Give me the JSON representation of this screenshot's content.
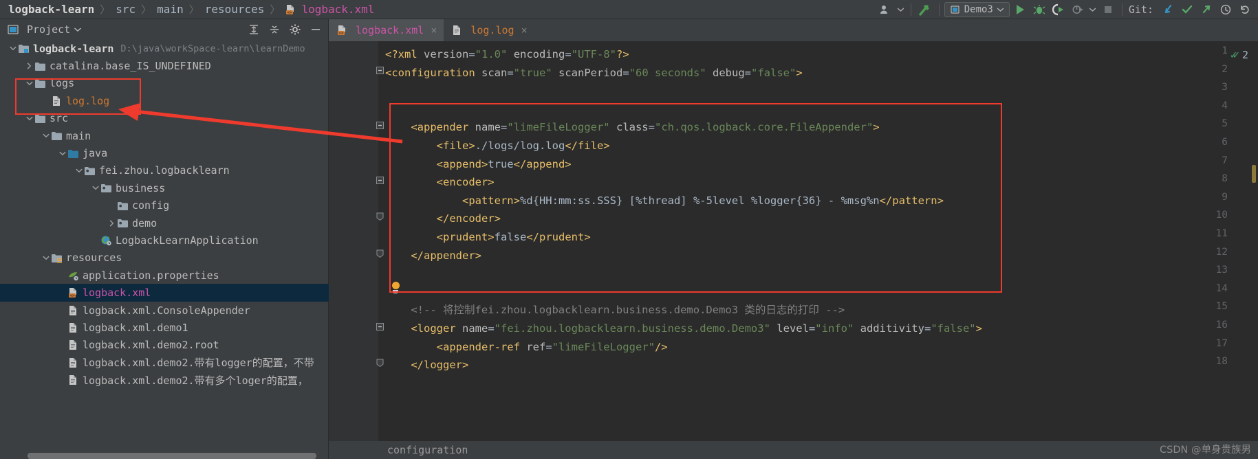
{
  "breadcrumb": {
    "items": [
      {
        "label": "logback-learn",
        "kind": "project"
      },
      {
        "label": "src",
        "kind": "dir"
      },
      {
        "label": "main",
        "kind": "dir"
      },
      {
        "label": "resources",
        "kind": "dir"
      },
      {
        "label": "logback.xml",
        "kind": "xml-file"
      }
    ],
    "separator": "〉"
  },
  "toolbar": {
    "run_config": "Demo3",
    "git_label": "Git:",
    "buttons": [
      {
        "name": "user-icon",
        "glyph": "♟"
      },
      {
        "name": "build-hammer-icon",
        "glyph": "⚒"
      },
      {
        "name": "run-button",
        "glyph": "▶"
      },
      {
        "name": "debug-button",
        "glyph": "✱"
      },
      {
        "name": "run-with-coverage-button",
        "glyph": "◐"
      },
      {
        "name": "profile-button",
        "glyph": "◔"
      },
      {
        "name": "stop-button",
        "glyph": "■"
      },
      {
        "name": "git-update-button",
        "glyph": "↙"
      },
      {
        "name": "git-commit-button",
        "glyph": "✓"
      },
      {
        "name": "git-push-button",
        "glyph": "↗"
      },
      {
        "name": "git-history-button",
        "glyph": "◴"
      },
      {
        "name": "git-rollback-button",
        "glyph": "↶"
      }
    ]
  },
  "project_panel": {
    "title": "Project",
    "header_buttons": [
      "expand-all",
      "collapse-all",
      "settings-gear",
      "hide-panel"
    ],
    "tree": [
      {
        "indent": 0,
        "arrow": "down",
        "icon": "module-folder",
        "label": "logback-learn",
        "bold": true,
        "path": "D:\\java\\workSpace-learn\\learnDemo"
      },
      {
        "indent": 1,
        "arrow": "right",
        "icon": "folder",
        "label": "catalina.base_IS_UNDEFINED"
      },
      {
        "indent": 1,
        "arrow": "down",
        "icon": "folder",
        "label": "logs"
      },
      {
        "indent": 2,
        "arrow": "none",
        "icon": "file",
        "label": "log.log",
        "color": "orange"
      },
      {
        "indent": 1,
        "arrow": "down",
        "icon": "folder",
        "label": "src"
      },
      {
        "indent": 2,
        "arrow": "down",
        "icon": "folder",
        "label": "main"
      },
      {
        "indent": 3,
        "arrow": "down",
        "icon": "source-folder",
        "label": "java"
      },
      {
        "indent": 4,
        "arrow": "down",
        "icon": "package",
        "label": "fei.zhou.logbacklearn"
      },
      {
        "indent": 5,
        "arrow": "down",
        "icon": "package",
        "label": "business"
      },
      {
        "indent": 6,
        "arrow": "none",
        "icon": "package",
        "label": "config"
      },
      {
        "indent": 6,
        "arrow": "right",
        "icon": "package",
        "label": "demo"
      },
      {
        "indent": 5,
        "arrow": "none",
        "icon": "spring-class",
        "label": "LogbackLearnApplication"
      },
      {
        "indent": 2,
        "arrow": "down",
        "icon": "resources-folder",
        "label": "resources"
      },
      {
        "indent": 3,
        "arrow": "none",
        "icon": "spring-properties",
        "label": "application.properties"
      },
      {
        "indent": 3,
        "arrow": "none",
        "icon": "xml-file",
        "label": "logback.xml",
        "color": "pink",
        "selected": true
      },
      {
        "indent": 3,
        "arrow": "none",
        "icon": "file",
        "label": "logback.xml.ConsoleAppender"
      },
      {
        "indent": 3,
        "arrow": "none",
        "icon": "file",
        "label": "logback.xml.demo1"
      },
      {
        "indent": 3,
        "arrow": "none",
        "icon": "file",
        "label": "logback.xml.demo2.root"
      },
      {
        "indent": 3,
        "arrow": "none",
        "icon": "file",
        "label": "logback.xml.demo2.带有logger的配置，不带"
      },
      {
        "indent": 3,
        "arrow": "none",
        "icon": "file",
        "label": "logback.xml.demo2.带有多个loger的配置，"
      }
    ]
  },
  "editor": {
    "tabs": [
      {
        "label": "logback.xml",
        "icon": "xml-file",
        "active": true,
        "close": "×"
      },
      {
        "label": "log.log",
        "icon": "file",
        "active": false,
        "close": "×"
      }
    ],
    "inspection_count": "2",
    "status_text": "configuration",
    "lines": [
      {
        "n": 1,
        "fold": "",
        "segments": [
          {
            "t": "<?xml ",
            "c": "tag"
          },
          {
            "t": "version",
            "c": "attr"
          },
          {
            "t": "=",
            "c": "txt"
          },
          {
            "t": "\"1.0\"",
            "c": "val"
          },
          {
            "t": " ",
            "c": "txt"
          },
          {
            "t": "encoding",
            "c": "attr"
          },
          {
            "t": "=",
            "c": "txt"
          },
          {
            "t": "\"UTF-8\"",
            "c": "val"
          },
          {
            "t": "?>",
            "c": "tag"
          }
        ]
      },
      {
        "n": 2,
        "fold": "minus",
        "segments": [
          {
            "t": "<configuration ",
            "c": "tag"
          },
          {
            "t": "scan",
            "c": "attr"
          },
          {
            "t": "=",
            "c": "txt"
          },
          {
            "t": "\"true\"",
            "c": "val"
          },
          {
            "t": " ",
            "c": "txt"
          },
          {
            "t": "scanPeriod",
            "c": "attr"
          },
          {
            "t": "=",
            "c": "txt"
          },
          {
            "t": "\"60 seconds\"",
            "c": "val"
          },
          {
            "t": " ",
            "c": "txt"
          },
          {
            "t": "debug",
            "c": "attr"
          },
          {
            "t": "=",
            "c": "txt"
          },
          {
            "t": "\"false\"",
            "c": "val"
          },
          {
            "t": ">",
            "c": "tag"
          }
        ]
      },
      {
        "n": 3,
        "fold": "",
        "segments": []
      },
      {
        "n": 4,
        "fold": "",
        "segments": []
      },
      {
        "n": 5,
        "fold": "minus",
        "indent": 4,
        "segments": [
          {
            "t": "<appender ",
            "c": "tag"
          },
          {
            "t": "name",
            "c": "attr"
          },
          {
            "t": "=",
            "c": "txt"
          },
          {
            "t": "\"limeFileLogger\"",
            "c": "val"
          },
          {
            "t": " ",
            "c": "txt"
          },
          {
            "t": "class",
            "c": "attr"
          },
          {
            "t": "=",
            "c": "txt"
          },
          {
            "t": "\"ch.qos.logback.core.FileAppender\"",
            "c": "val"
          },
          {
            "t": ">",
            "c": "tag"
          }
        ]
      },
      {
        "n": 6,
        "fold": "",
        "indent": 8,
        "segments": [
          {
            "t": "<file>",
            "c": "tag"
          },
          {
            "t": "./logs/log.log",
            "c": "txt"
          },
          {
            "t": "</file>",
            "c": "tag"
          }
        ]
      },
      {
        "n": 7,
        "fold": "",
        "indent": 8,
        "segments": [
          {
            "t": "<append>",
            "c": "tag"
          },
          {
            "t": "true",
            "c": "txt"
          },
          {
            "t": "</append>",
            "c": "tag"
          }
        ]
      },
      {
        "n": 8,
        "fold": "minus",
        "indent": 8,
        "segments": [
          {
            "t": "<encoder>",
            "c": "tag"
          }
        ]
      },
      {
        "n": 9,
        "fold": "",
        "indent": 12,
        "segments": [
          {
            "t": "<pattern>",
            "c": "tag"
          },
          {
            "t": "%d{HH:mm:ss.SSS} [%thread] %-5level %logger{36} - %msg%n",
            "c": "txt"
          },
          {
            "t": "</pattern>",
            "c": "tag"
          }
        ]
      },
      {
        "n": 10,
        "fold": "end",
        "indent": 8,
        "segments": [
          {
            "t": "</encoder>",
            "c": "tag"
          }
        ]
      },
      {
        "n": 11,
        "fold": "",
        "indent": 8,
        "segments": [
          {
            "t": "<prudent>",
            "c": "tag"
          },
          {
            "t": "false",
            "c": "txt"
          },
          {
            "t": "</prudent>",
            "c": "tag"
          }
        ]
      },
      {
        "n": 12,
        "fold": "end",
        "indent": 4,
        "segments": [
          {
            "t": "</appender>",
            "c": "tag"
          }
        ]
      },
      {
        "n": 13,
        "fold": "",
        "segments": []
      },
      {
        "n": 14,
        "fold": "",
        "segments": []
      },
      {
        "n": 15,
        "fold": "",
        "indent": 4,
        "segments": [
          {
            "t": "<!-- 将控制fei.zhou.logbacklearn.business.demo.Demo3 类的日志的打印 -->",
            "c": "comment"
          }
        ]
      },
      {
        "n": 16,
        "fold": "minus",
        "indent": 4,
        "segments": [
          {
            "t": "<logger ",
            "c": "tag"
          },
          {
            "t": "name",
            "c": "attr"
          },
          {
            "t": "=",
            "c": "txt"
          },
          {
            "t": "\"fei.zhou.logbacklearn.business.demo.Demo3\"",
            "c": "val"
          },
          {
            "t": " ",
            "c": "txt"
          },
          {
            "t": "level",
            "c": "attr"
          },
          {
            "t": "=",
            "c": "txt"
          },
          {
            "t": "\"info\"",
            "c": "val"
          },
          {
            "t": " ",
            "c": "txt"
          },
          {
            "t": "additivity",
            "c": "attr"
          },
          {
            "t": "=",
            "c": "txt"
          },
          {
            "t": "\"false\"",
            "c": "val"
          },
          {
            "t": ">",
            "c": "tag"
          }
        ]
      },
      {
        "n": 17,
        "fold": "",
        "indent": 8,
        "segments": [
          {
            "t": "<appender-ref ",
            "c": "tag"
          },
          {
            "t": "ref",
            "c": "attr"
          },
          {
            "t": "=",
            "c": "txt"
          },
          {
            "t": "\"limeFileLogger\"",
            "c": "val"
          },
          {
            "t": "/>",
            "c": "tag"
          }
        ]
      },
      {
        "n": 18,
        "fold": "end",
        "indent": 4,
        "segments": [
          {
            "t": "</logger>",
            "c": "tag"
          }
        ]
      }
    ]
  },
  "watermark": "CSDN @单身贵族男",
  "colors": {
    "accent_pink": "#cc54a8",
    "annotation_red": "#ef3b2d",
    "tag_gold": "#e8bf6a",
    "string_green": "#6a8759",
    "selection_blue": "#0d293e"
  }
}
